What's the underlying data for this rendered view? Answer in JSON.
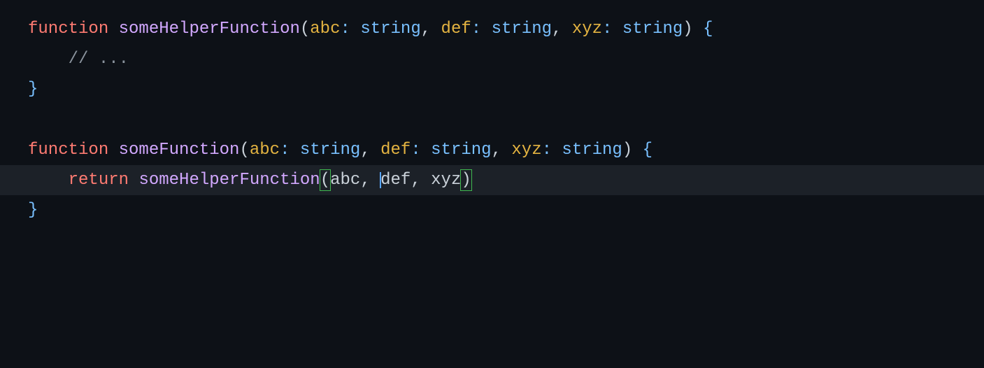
{
  "colors": {
    "background": "#0d1117",
    "keyword": "#ff7b72",
    "function_name": "#d2a8ff",
    "parameter": "#e3b341",
    "type": "#79c0ff",
    "punctuation": "#c9d1d9",
    "comment": "#8b949e",
    "brace": "#79c0ff",
    "bracket_match_border": "#3fb950",
    "cursor": "#58a6ff",
    "line_highlight": "#1c2128"
  },
  "code": {
    "kw_function": "function",
    "fn1_name": "someHelperFunction",
    "fn2_name": "someFunction",
    "paren_open": "(",
    "paren_close": ")",
    "param_abc": "abc",
    "param_def": "def",
    "param_xyz": "xyz",
    "colon": ":",
    "type_string": "string",
    "comma": ",",
    "space": " ",
    "brace_open": "{",
    "brace_close": "}",
    "indent4": "    ",
    "comment_body": "// ...",
    "kw_return": "return",
    "call_name": "someHelperFunction",
    "arg_abc": "abc",
    "arg_def": "def",
    "arg_xyz": "xyz"
  },
  "editor_state": {
    "cursor_line": 7,
    "cursor_before_token": "def",
    "highlighted_line": 7,
    "bracket_pair_matched": true
  }
}
